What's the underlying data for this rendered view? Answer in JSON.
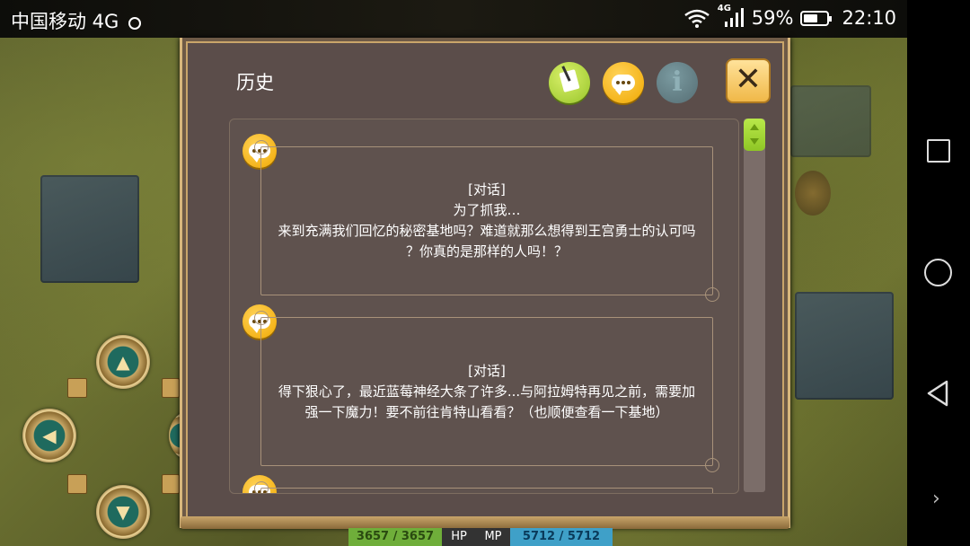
{
  "status_bar": {
    "carrier": "中国移动 4G",
    "network_badge": "4G",
    "battery": "59%",
    "time": "22:10"
  },
  "dialog": {
    "title": "历史",
    "close_symbol": "✕",
    "info_symbol": "i",
    "entries": [
      {
        "lines": [
          "[对话]",
          "为了抓我…",
          "来到充满我们回忆的秘密基地吗？难道就那么想得到王宫勇士的认可吗",
          "？你真的是那样的人吗！？"
        ]
      },
      {
        "lines": [
          "[对话]",
          "得下狠心了，最近蓝莓神经大条了许多...与阿拉姆特再见之前，需要加",
          "强一下魔力！要不前往肯特山看看？（也顺便查看一下基地）"
        ]
      }
    ]
  },
  "stats": {
    "hp_value": "3657 / 3657",
    "hp_label": "HP",
    "mp_label": "MP",
    "mp_value": "5712 / 5712"
  },
  "icons": [
    "note-icon",
    "chat-icon",
    "info-icon",
    "close-icon",
    "wifi-icon",
    "signal-icon",
    "battery-icon",
    "alarm-icon"
  ],
  "colors": {
    "accent_yellow": "#f0a800",
    "accent_green": "#98c52a",
    "panel": "#5b4d4a",
    "border": "#d8b77c"
  }
}
